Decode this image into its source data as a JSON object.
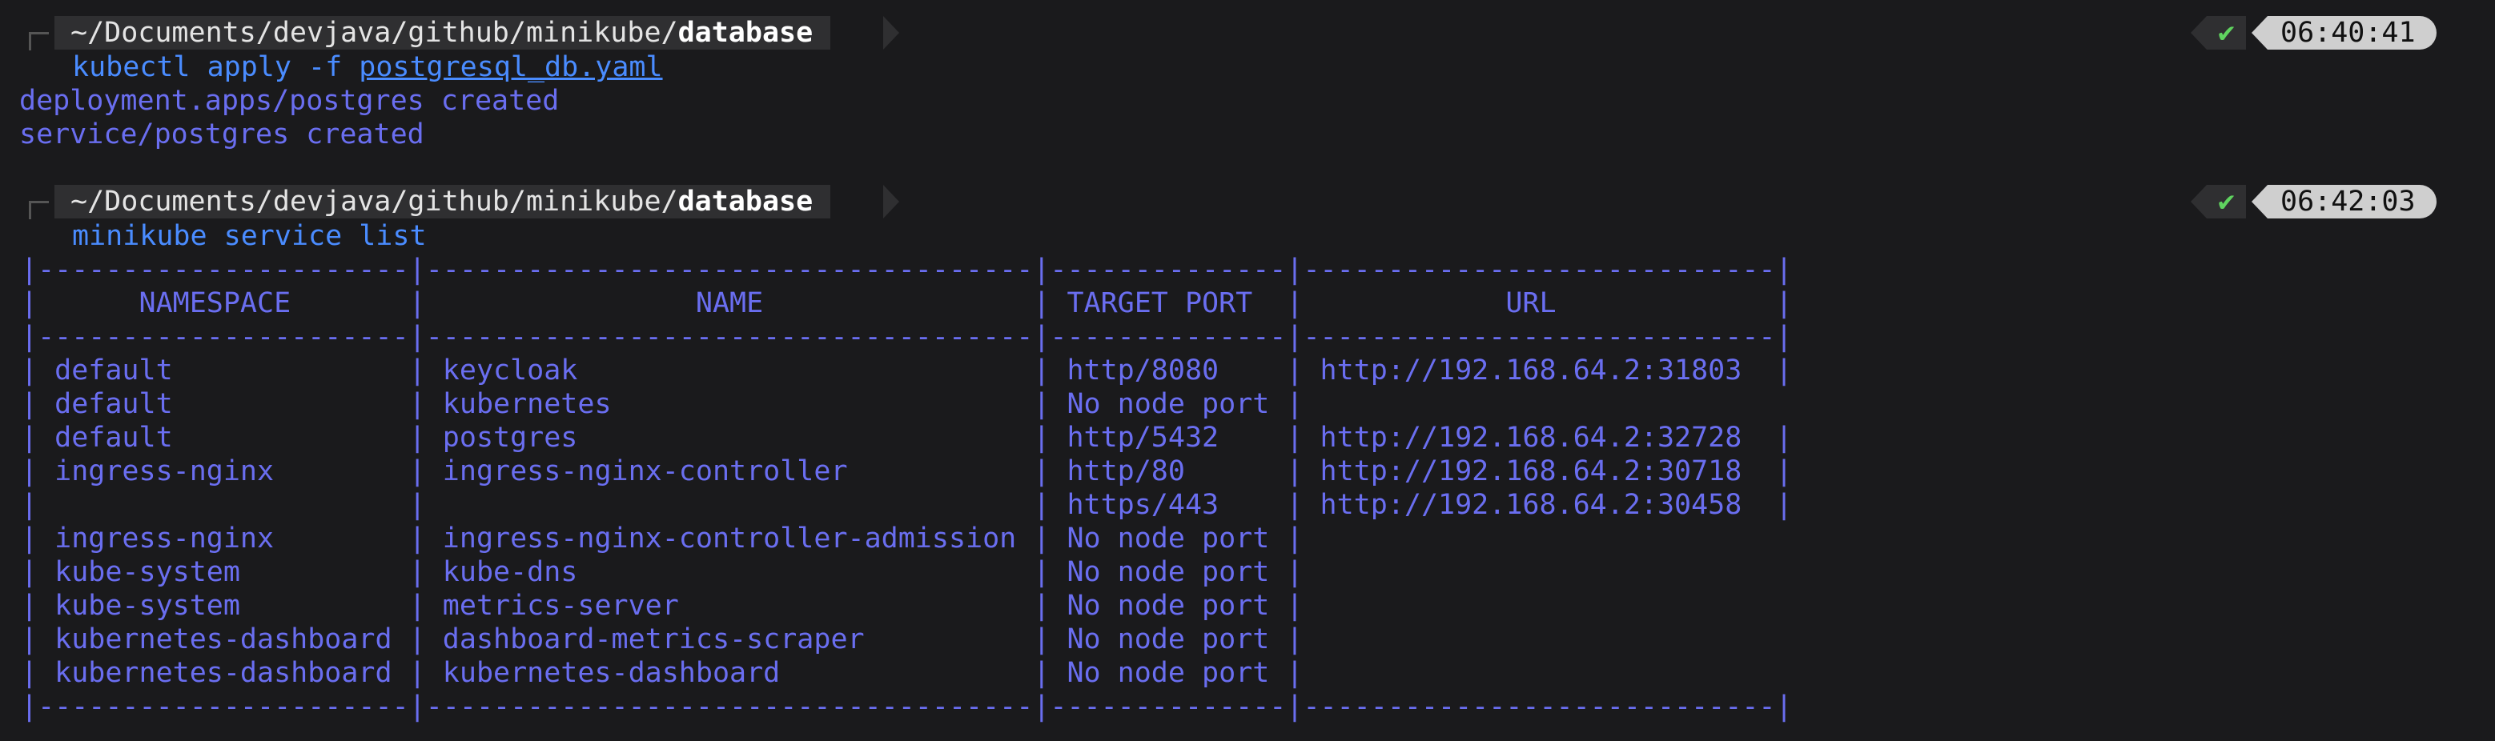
{
  "prompts": [
    {
      "path_prefix": "~/Documents/devjava/github/minikube/",
      "path_dir": "database",
      "status_icon": "✔",
      "time": "06:40:41",
      "command": {
        "program": "kubectl",
        "args": "apply -f",
        "file": "postgresql_db.yaml"
      },
      "output": [
        "deployment.apps/postgres created",
        "service/postgres created"
      ]
    },
    {
      "path_prefix": "~/Documents/devjava/github/minikube/",
      "path_dir": "database",
      "status_icon": "✔",
      "time": "06:42:03",
      "command": {
        "program": "minikube",
        "args": "service list"
      }
    }
  ],
  "table": {
    "border": "|----------------------|------------------------------------|--------------|----------------------------|",
    "headers": [
      "NAMESPACE",
      "NAME",
      "TARGET PORT",
      "URL"
    ],
    "rows": [
      [
        "default",
        "keycloak",
        "http/8080",
        "http://192.168.64.2:31803"
      ],
      [
        "default",
        "kubernetes",
        "No node port",
        ""
      ],
      [
        "default",
        "postgres",
        "http/5432",
        "http://192.168.64.2:32728"
      ],
      [
        "ingress-nginx",
        "ingress-nginx-controller",
        "http/80",
        "http://192.168.64.2:30718"
      ],
      [
        "",
        "",
        "https/443",
        "http://192.168.64.2:30458"
      ],
      [
        "ingress-nginx",
        "ingress-nginx-controller-admission",
        "No node port",
        ""
      ],
      [
        "kube-system",
        "kube-dns",
        "No node port",
        ""
      ],
      [
        "kube-system",
        "metrics-server",
        "No node port",
        ""
      ],
      [
        "kubernetes-dashboard",
        "dashboard-metrics-scraper",
        "No node port",
        ""
      ],
      [
        "kubernetes-dashboard",
        "kubernetes-dashboard",
        "No node port",
        ""
      ]
    ]
  },
  "colors": {
    "background": "#1a1a1c",
    "output": "#6a6ef0",
    "command": "#4a8cff",
    "ok": "#5fd35f"
  }
}
